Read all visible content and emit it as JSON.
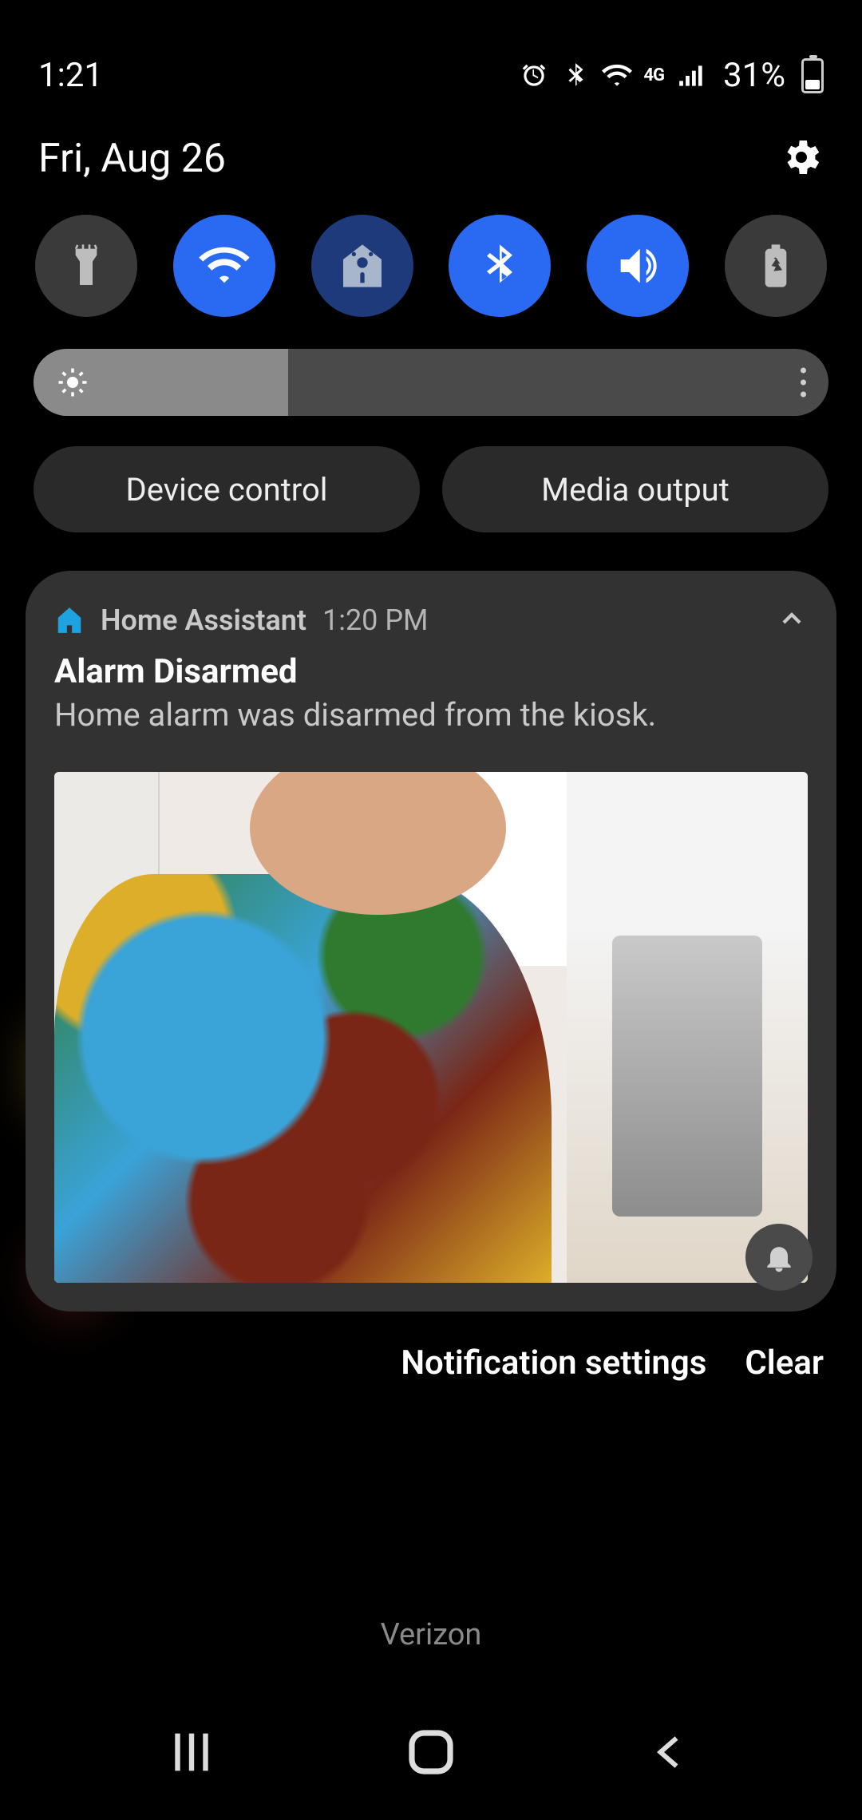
{
  "status": {
    "time": "1:21",
    "network_type": "4G",
    "battery_percent": "31%",
    "battery_level": 31
  },
  "panel": {
    "date": "Fri, Aug 26",
    "brightness_percent": 32,
    "chips": {
      "device_control": "Device control",
      "media_output": "Media output"
    }
  },
  "toggles": {
    "flashlight": {
      "state": "off"
    },
    "wifi": {
      "state": "on"
    },
    "smart_home": {
      "state": "dim"
    },
    "bluetooth": {
      "state": "on"
    },
    "sound": {
      "state": "on"
    },
    "power_save": {
      "state": "off"
    }
  },
  "notification": {
    "app_name": "Home Assistant",
    "timestamp": "1:20 PM",
    "title": "Alarm Disarmed",
    "body": "Home alarm was disarmed from the kiosk."
  },
  "footer": {
    "settings_link": "Notification settings",
    "clear": "Clear",
    "carrier": "Verizon"
  }
}
